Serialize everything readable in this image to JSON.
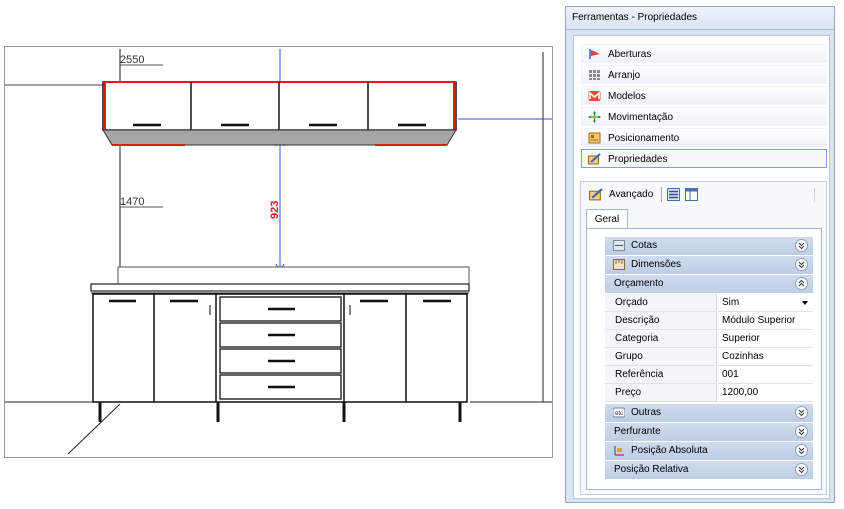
{
  "drawing": {
    "dim_top": "2550",
    "dim_mid": "1470",
    "dim_gap": "923"
  },
  "panel": {
    "title": "Ferramentas - Propriedades",
    "nav_items": [
      {
        "label": "Aberturas",
        "icon": "door-opening-icon"
      },
      {
        "label": "Arranjo",
        "icon": "grid-arrange-icon"
      },
      {
        "label": "Modelos",
        "icon": "models-icon"
      },
      {
        "label": "Movimentação",
        "icon": "move-arrows-icon"
      },
      {
        "label": "Posicionamento",
        "icon": "position-icon"
      },
      {
        "label": "Propriedades",
        "icon": "properties-icon"
      }
    ],
    "advanced": {
      "label": "Avançado",
      "tab": "Geral",
      "categories": {
        "cotas": "Cotas",
        "dimensoes": "Dimensões",
        "orcamento": "Orçamento",
        "outras": "Outras",
        "perfurante": "Perfurante",
        "posicao_absoluta": "Posição Absoluta",
        "posicao_relativa": "Posição Relativa"
      },
      "orcamento_rows": [
        {
          "key": "Orçado",
          "value": "Sim"
        },
        {
          "key": "Descrição",
          "value": "Módulo Superior"
        },
        {
          "key": "Categoria",
          "value": "Superior"
        },
        {
          "key": "Grupo",
          "value": "Cozinhas"
        },
        {
          "key": "Referência",
          "value": "001"
        },
        {
          "key": "Preço",
          "value": "1200,00"
        }
      ]
    }
  },
  "colors": {
    "accent_blue": "#2d4bd8",
    "dimension_red": "#e11b1b",
    "category_band": "#c6d5ea"
  }
}
